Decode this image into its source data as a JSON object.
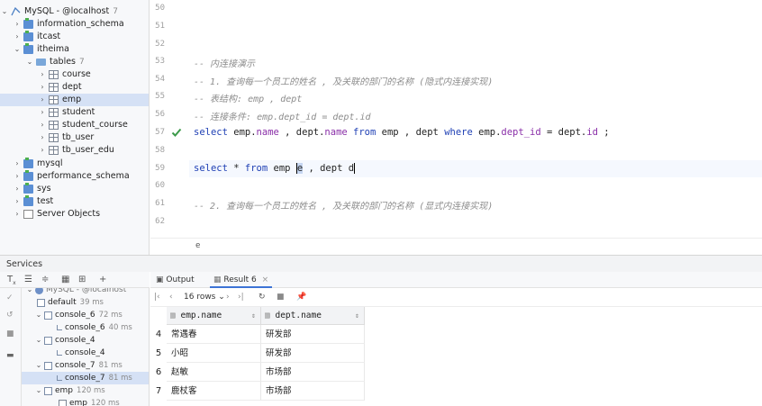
{
  "tree": {
    "root": {
      "label": "MySQL - @localhost",
      "count": "7"
    },
    "schemas": [
      {
        "label": "information_schema"
      },
      {
        "label": "itcast"
      },
      {
        "label": "itheima"
      }
    ],
    "tables_folder": {
      "label": "tables",
      "count": "7"
    },
    "tables": [
      "course",
      "dept",
      "emp",
      "student",
      "student_course",
      "tb_user",
      "tb_user_edu"
    ],
    "more_schemas": [
      "mysql",
      "performance_schema",
      "sys",
      "test"
    ],
    "server_objects": "Server Objects"
  },
  "editor": {
    "lines": [
      {
        "no": "50",
        "text": ""
      },
      {
        "no": "51",
        "text": ""
      },
      {
        "no": "52",
        "text": ""
      },
      {
        "no": "53",
        "text": "-- 内连接演示"
      },
      {
        "no": "54",
        "text": "-- 1. 查询每一个员工的姓名 , 及关联的部门的名称 (隐式内连接实现)"
      },
      {
        "no": "55",
        "text": "-- 表结构: emp , dept"
      },
      {
        "no": "56",
        "text": "-- 连接条件: emp.dept_id = dept.id"
      },
      {
        "no": "57",
        "text": "select emp.name , dept.name from emp , dept where emp.dept_id = dept.id ;"
      },
      {
        "no": "58",
        "text": ""
      },
      {
        "no": "59",
        "text": "select * from emp e , dept d"
      },
      {
        "no": "60",
        "text": ""
      },
      {
        "no": "61",
        "text": "-- 2. 查询每一个员工的姓名 , 及关联的部门的名称 (显式内连接实现)"
      },
      {
        "no": "62",
        "text": ""
      }
    ],
    "line57": {
      "t1": "select",
      "t2": " emp.",
      "t3": "name",
      "t4": " , dept.",
      "t5": "name",
      "t6": " from",
      "t7": " emp , dept ",
      "t8": "where",
      "t9": " emp.",
      "t10": "dept_id",
      "t11": " = dept.",
      "t12": "id",
      "t13": " ;"
    },
    "line59": {
      "t1": "select",
      "t2": " * ",
      "t3": "from",
      "t4": " emp ",
      "t5": "e",
      "t6": " , dept ",
      "t7": "d"
    },
    "breadcrumb": "e"
  },
  "services": {
    "title": "Services",
    "tree": [
      {
        "label": "MySQL - @localhost",
        "ms": ""
      },
      {
        "label": "default",
        "ms": "39 ms"
      },
      {
        "label": "console_6",
        "ms": "72 ms"
      },
      {
        "label": "console_6",
        "ms": "40 ms"
      },
      {
        "label": "console_4",
        "ms": ""
      },
      {
        "label": "console_4",
        "ms": ""
      },
      {
        "label": "console_7",
        "ms": "81 ms"
      },
      {
        "label": "console_7",
        "ms": "81 ms"
      },
      {
        "label": "emp",
        "ms": "120 ms"
      },
      {
        "label": "emp",
        "ms": "120 ms"
      }
    ]
  },
  "results": {
    "tabs": [
      {
        "label": "Output"
      },
      {
        "label": "Result 6"
      }
    ],
    "rows_selector": "16 rows",
    "columns": [
      "emp.name",
      "dept.name"
    ],
    "rows": [
      {
        "no": "4",
        "name": "常遇春",
        "dept": "研发部"
      },
      {
        "no": "5",
        "name": "小昭",
        "dept": "研发部"
      },
      {
        "no": "6",
        "name": "赵敏",
        "dept": "市场部"
      },
      {
        "no": "7",
        "name": "鹿杖客",
        "dept": "市场部"
      }
    ]
  },
  "colors": {
    "keyword": "#1e3fb4",
    "field": "#8a2fa8",
    "comment": "#8c8c8c",
    "selection": "#d5e1f5",
    "check": "#3c9a4a"
  }
}
